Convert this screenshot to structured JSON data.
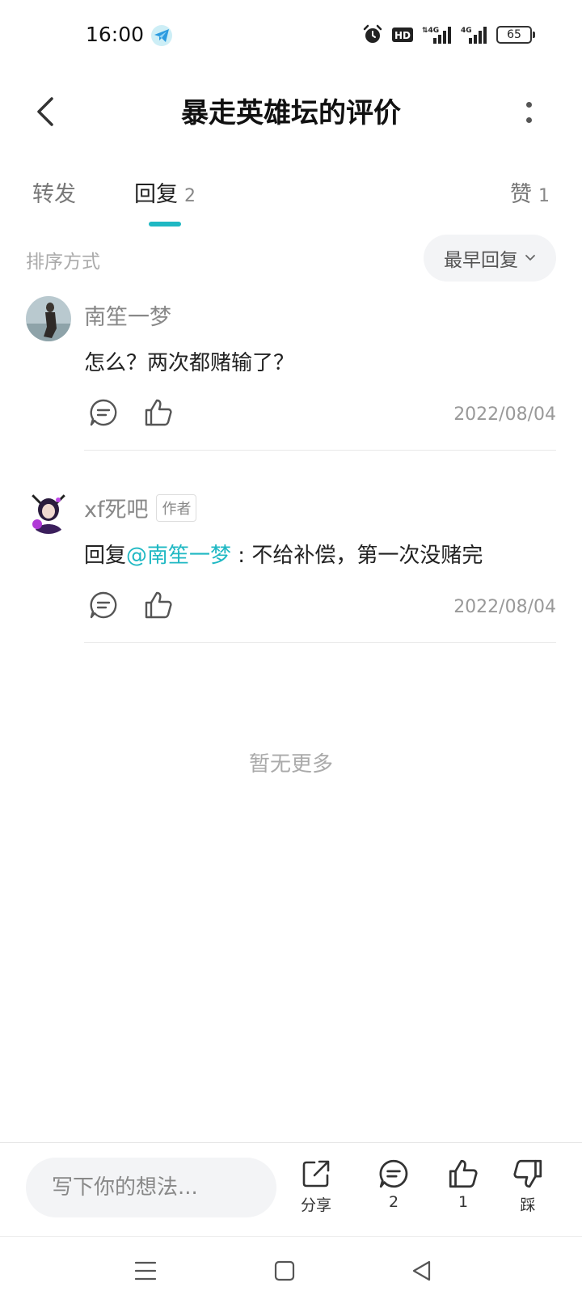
{
  "status_bar": {
    "time": "16:00",
    "battery": "65",
    "icons": [
      "telegram-app-icon",
      "alarm-icon",
      "hd-icon",
      "signal-4g-icon",
      "signal-4g-icon",
      "battery-icon"
    ]
  },
  "header": {
    "title": "暴走英雄坛的评价"
  },
  "tabs": {
    "forward": {
      "label": "转发"
    },
    "reply": {
      "label": "回复",
      "count": "2"
    },
    "like": {
      "label": "赞",
      "count": "1"
    }
  },
  "sort": {
    "label": "排序方式",
    "selected": "最早回复"
  },
  "comments": [
    {
      "user": "南笙一梦",
      "text": "怎么？两次都赌输了？",
      "date": "2022/08/04"
    },
    {
      "user": "xf死吧",
      "badge": "作者",
      "reply_prefix": "回复",
      "mention": "@南笙一梦",
      "text": " : 不给补偿，第一次没赌完",
      "date": "2022/08/04"
    }
  ],
  "no_more": "暂无更多",
  "bottom_bar": {
    "input_placeholder": "写下你的想法...",
    "share_label": "分享",
    "comment_count": "2",
    "like_count": "1",
    "dislike_label": "踩"
  },
  "colors": {
    "accent": "#1fb8c3",
    "text_primary": "#222222",
    "text_secondary": "#888888",
    "pill_bg": "#f3f4f6"
  }
}
